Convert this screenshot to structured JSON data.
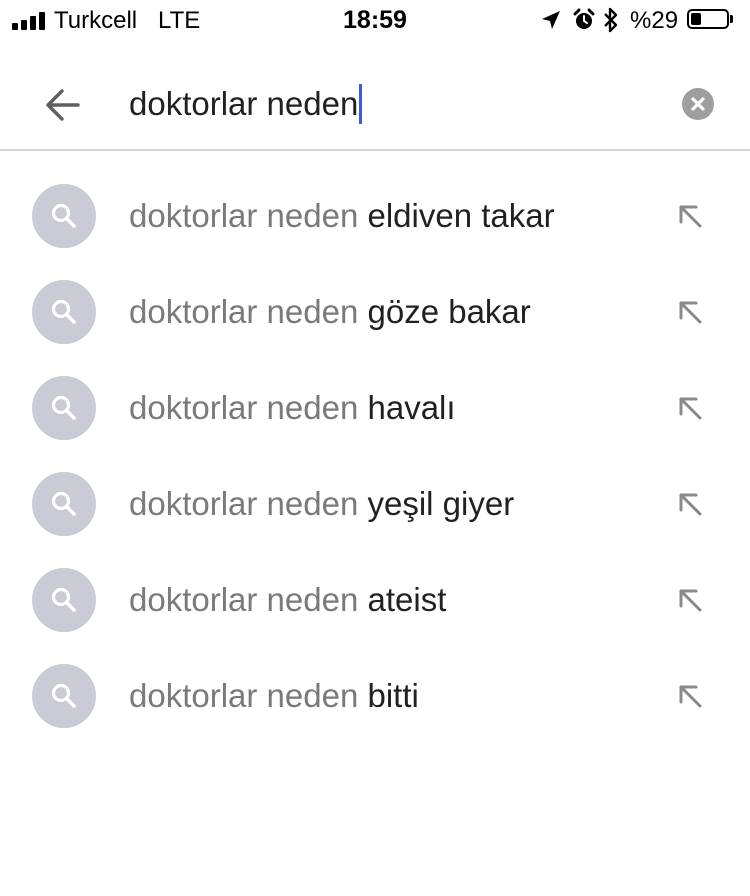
{
  "status_bar": {
    "carrier": "Turkcell",
    "network": "LTE",
    "time": "18:59",
    "battery_percent": "%29",
    "battery_level": 0.29,
    "icons": [
      "signal-icon",
      "location-icon",
      "alarm-icon",
      "bluetooth-icon",
      "battery-icon"
    ]
  },
  "search": {
    "query": "doktorlar neden",
    "back_icon": "arrow-back-icon",
    "clear_icon": "clear-icon"
  },
  "suggestions": [
    {
      "prefix": "doktorlar neden",
      "suffix": "eldiven takar"
    },
    {
      "prefix": "doktorlar neden",
      "suffix": "göze bakar"
    },
    {
      "prefix": "doktorlar neden",
      "suffix": "havalı"
    },
    {
      "prefix": "doktorlar neden",
      "suffix": "yeşil giyer"
    },
    {
      "prefix": "doktorlar neden",
      "suffix": "ateist"
    },
    {
      "prefix": "doktorlar neden",
      "suffix": "bitti"
    }
  ],
  "colors": {
    "caret": "#3b5bd8",
    "suggestion_prefix": "#7a7a7a",
    "suggestion_suffix": "#212121",
    "search_icon_bg": "#c9ccd4"
  }
}
